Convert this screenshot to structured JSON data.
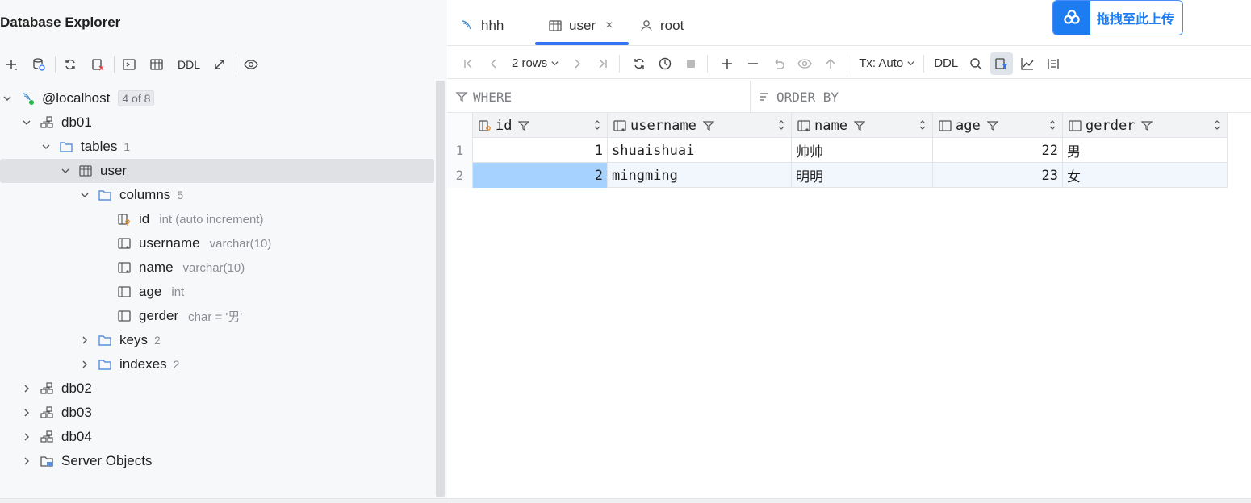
{
  "explorer": {
    "title": "Database Explorer",
    "toolbar": {
      "ddl_label": "DDL"
    },
    "tree": {
      "host": {
        "label": "@localhost",
        "badge": "4 of 8"
      },
      "db01": {
        "label": "db01"
      },
      "tables": {
        "label": "tables",
        "count": "1"
      },
      "user": {
        "label": "user"
      },
      "columns": {
        "label": "columns",
        "count": "5"
      },
      "cols": [
        {
          "name": "id",
          "type": "int (auto increment)"
        },
        {
          "name": "username",
          "type": "varchar(10)"
        },
        {
          "name": "name",
          "type": "varchar(10)"
        },
        {
          "name": "age",
          "type": "int"
        },
        {
          "name": "gerder",
          "type": "char = '男'"
        }
      ],
      "keys": {
        "label": "keys",
        "count": "2"
      },
      "indexes": {
        "label": "indexes",
        "count": "2"
      },
      "db02": {
        "label": "db02"
      },
      "db03": {
        "label": "db03"
      },
      "db04": {
        "label": "db04"
      },
      "server_objects": {
        "label": "Server Objects"
      }
    }
  },
  "editor": {
    "tabs": [
      {
        "label": "hhh"
      },
      {
        "label": "user",
        "close": "×"
      },
      {
        "label": "root"
      }
    ],
    "upload_badge": "拖拽至此上传",
    "toolbar": {
      "rows_label": "2 rows",
      "tx_label": "Tx: Auto",
      "ddl_label": "DDL"
    },
    "filter": {
      "where": "WHERE",
      "order_by": "ORDER BY"
    },
    "grid": {
      "columns": [
        "id",
        "username",
        "name",
        "age",
        "gerder"
      ],
      "rows": [
        {
          "num": "1",
          "id": "1",
          "username": "shuaishuai",
          "name": "帅帅",
          "age": "22",
          "gerder": "男"
        },
        {
          "num": "2",
          "id": "2",
          "username": "mingming",
          "name": "明明",
          "age": "23",
          "gerder": "女"
        }
      ]
    }
  },
  "colors": {
    "accent": "#3574f0",
    "selection": "#a6d2ff",
    "folder": "#5a8fdc"
  }
}
